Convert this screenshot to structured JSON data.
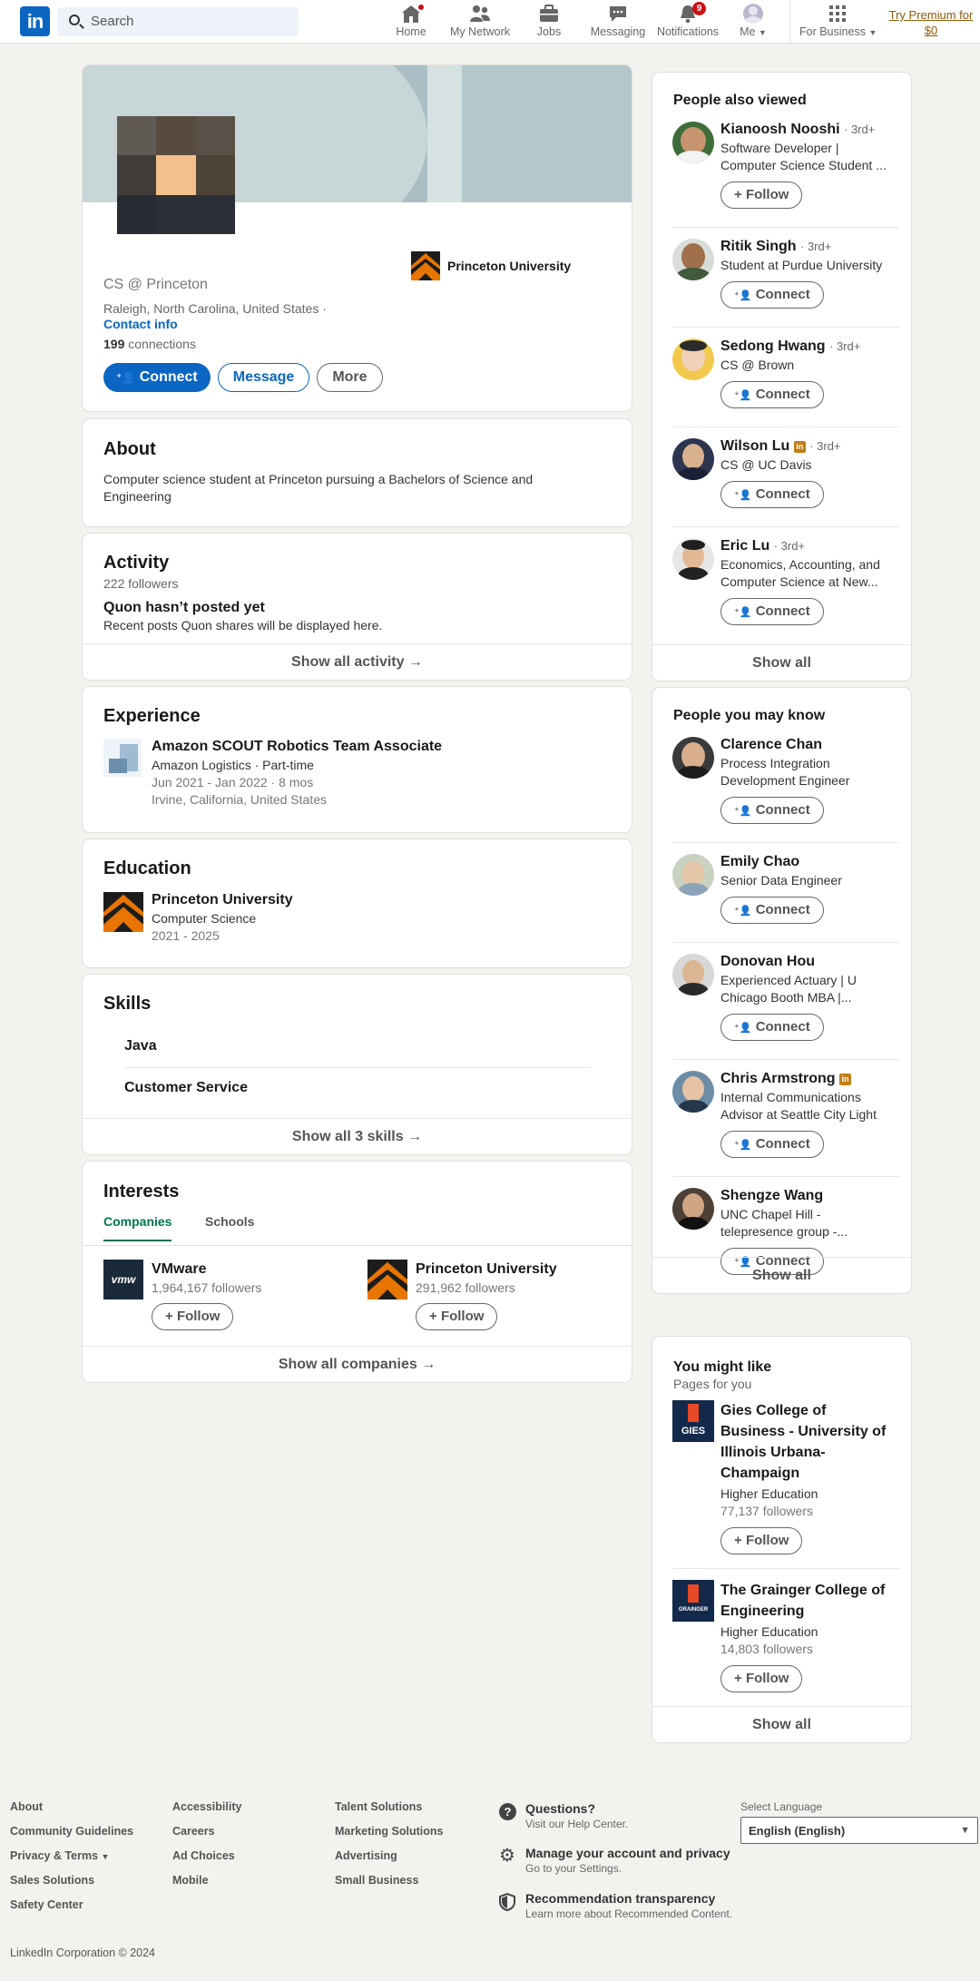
{
  "nav": {
    "logo": "in",
    "search_placeholder": "Search",
    "items": [
      {
        "label": "Home",
        "icon": "home-icon"
      },
      {
        "label": "My Network",
        "icon": "people-icon"
      },
      {
        "label": "Jobs",
        "icon": "briefcase-icon"
      },
      {
        "label": "Messaging",
        "icon": "chat-icon"
      },
      {
        "label": "Notifications",
        "icon": "bell-icon",
        "badge": "9"
      },
      {
        "label": "Me",
        "icon": "avatar"
      },
      {
        "label": "For Business",
        "icon": "grid-icon"
      }
    ],
    "premium_line1": "Try Premium for",
    "premium_line2": "$0"
  },
  "profile": {
    "school_badge": "Princeton University",
    "headline": "CS @ Princeton",
    "location": "Raleigh, North Carolina, United States ·",
    "contact_info": "Contact info",
    "connections_count": "199",
    "connections_label": "connections",
    "connect_label": "Connect",
    "message_label": "Message",
    "more_label": "More"
  },
  "about": {
    "title": "About",
    "text": "Computer science student at Princeton pursuing a Bachelors of Science and Engineering"
  },
  "activity": {
    "title": "Activity",
    "followers": "222 followers",
    "empty_title": "Quon hasn’t posted yet",
    "empty_text": "Recent posts Quon shares will be displayed here.",
    "show_all": "Show all activity →"
  },
  "experience": {
    "title": "Experience",
    "role": "Amazon SCOUT Robotics Team Associate",
    "company": "Amazon Logistics · Part-time",
    "dates": "Jun 2021 - Jan 2022 · 8 mos",
    "location": "Irvine, California, United States"
  },
  "education": {
    "title": "Education",
    "school": "Princeton University",
    "field": "Computer Science",
    "years": "2021 - 2025"
  },
  "skills": {
    "title": "Skills",
    "items": [
      "Java",
      "Customer Service"
    ],
    "show_all": "Show all 3 skills →"
  },
  "interests": {
    "title": "Interests",
    "tabs": [
      "Companies",
      "Schools"
    ],
    "items": [
      {
        "name": "VMware",
        "followers": "1,964,167 followers",
        "follow": "Follow",
        "logo_text": "vmw"
      },
      {
        "name": "Princeton University",
        "followers": "291,962 followers",
        "follow": "Follow"
      }
    ],
    "show_all": "Show all companies →"
  },
  "also_viewed": {
    "title": "People also viewed",
    "people": [
      {
        "name": "Kianoosh Nooshi",
        "degree": "· 3rd+",
        "headline": "Software Developer | Computer Science Student ...",
        "action": "Follow"
      },
      {
        "name": "Ritik Singh",
        "degree": "· 3rd+",
        "headline": "Student at Purdue University",
        "action": "Connect"
      },
      {
        "name": "Sedong Hwang",
        "degree": "· 3rd+",
        "headline": "CS @ Brown",
        "action": "Connect"
      },
      {
        "name": "Wilson Lu",
        "degree": "· 3rd+",
        "headline": "CS @ UC Davis",
        "action": "Connect",
        "premium": "in"
      },
      {
        "name": "Eric Lu",
        "degree": "· 3rd+",
        "headline": "Economics, Accounting, and Computer Science at New...",
        "action": "Connect"
      }
    ],
    "show_all": "Show all"
  },
  "may_know": {
    "title": "People you may know",
    "people": [
      {
        "name": "Clarence Chan",
        "headline": "Process Integration Development Engineer",
        "action": "Connect"
      },
      {
        "name": "Emily Chao",
        "headline": "Senior Data Engineer",
        "action": "Connect"
      },
      {
        "name": "Donovan Hou",
        "headline": "Experienced Actuary | U Chicago Booth MBA |...",
        "action": "Connect"
      },
      {
        "name": "Chris Armstrong",
        "headline": "Internal Communications Advisor at Seattle City Light",
        "action": "Connect",
        "premium": "in"
      },
      {
        "name": "Shengze Wang",
        "headline": "UNC Chapel Hill - telepresence group -...",
        "action": "Connect"
      }
    ],
    "show_all": "Show all"
  },
  "might_like": {
    "title": "You might like",
    "subtitle": "Pages for you",
    "pages": [
      {
        "name": "Gies College of Business - University of Illinois Urbana-Champaign",
        "category": "Higher Education",
        "followers": "77,137 followers",
        "action": "Follow",
        "logo_text": "GIES"
      },
      {
        "name": "The Grainger College of Engineering",
        "category": "Higher Education",
        "followers": "14,803 followers",
        "action": "Follow",
        "logo_text": "GRAINGER"
      }
    ],
    "show_all": "Show all"
  },
  "footer": {
    "col1": [
      "About",
      "Community Guidelines",
      "Privacy & Terms",
      "Sales Solutions",
      "Safety Center"
    ],
    "col2": [
      "Accessibility",
      "Careers",
      "Ad Choices",
      "Mobile"
    ],
    "col3": [
      "Talent Solutions",
      "Marketing Solutions",
      "Advertising",
      "Small Business"
    ],
    "help": [
      {
        "title": "Questions?",
        "sub": "Visit our Help Center."
      },
      {
        "title": "Manage your account and privacy",
        "sub": "Go to your Settings."
      },
      {
        "title": "Recommendation transparency",
        "sub": "Learn more about Recommended Content."
      }
    ],
    "language_label": "Select Language",
    "language_value": "English (English)",
    "copyright": "LinkedIn Corporation © 2024"
  },
  "colors": {
    "brand": "#0a66c2",
    "premium": "#915907",
    "badge": "#cc1016",
    "princeton": "#e77500",
    "illinois": "#13294b"
  }
}
